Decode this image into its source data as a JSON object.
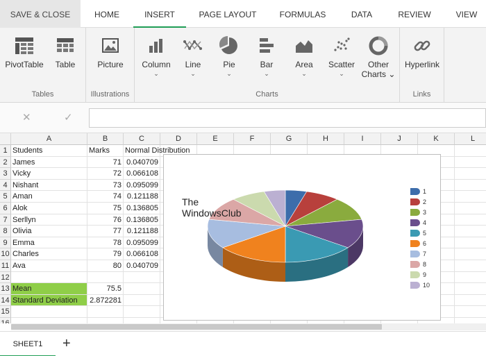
{
  "tabs": {
    "save": "SAVE & CLOSE",
    "home": "HOME",
    "insert": "INSERT",
    "page_layout": "PAGE LAYOUT",
    "formulas": "FORMULAS",
    "data": "DATA",
    "review": "REVIEW",
    "view": "VIEW"
  },
  "ribbon": {
    "pivottable": "PivotTable",
    "table": "Table",
    "picture": "Picture",
    "column": "Column",
    "line": "Line",
    "pie": "Pie",
    "bar": "Bar",
    "area": "Area",
    "scatter": "Scatter",
    "other_charts_1": "Other",
    "other_charts_2": "Charts",
    "hyperlink": "Hyperlink",
    "group_tables": "Tables",
    "group_illustrations": "Illustrations",
    "group_charts": "Charts",
    "group_links": "Links",
    "chevron": "⌄"
  },
  "formula_bar": {
    "cancel": "✕",
    "confirm": "✓",
    "value": ""
  },
  "columns": [
    "A",
    "B",
    "C",
    "D",
    "E",
    "F",
    "G",
    "H",
    "I",
    "J",
    "K",
    "L"
  ],
  "rows": [
    "1",
    "2",
    "3",
    "4",
    "5",
    "6",
    "7",
    "8",
    "9",
    "10",
    "11",
    "12",
    "13",
    "14",
    "15",
    "16"
  ],
  "sheet": {
    "header": {
      "students": "Students",
      "marks": "Marks",
      "normal": "Normal Distribution"
    },
    "records": [
      {
        "name": "James",
        "marks": "71",
        "nd": "0.040709"
      },
      {
        "name": "Vicky",
        "marks": "72",
        "nd": "0.066108"
      },
      {
        "name": "Nishant",
        "marks": "73",
        "nd": "0.095099"
      },
      {
        "name": "Aman",
        "marks": "74",
        "nd": "0.121188"
      },
      {
        "name": "Alok",
        "marks": "75",
        "nd": "0.136805"
      },
      {
        "name": "Serllyn",
        "marks": "76",
        "nd": "0.136805"
      },
      {
        "name": "Olivia",
        "marks": "77",
        "nd": "0.121188"
      },
      {
        "name": "Emma",
        "marks": "78",
        "nd": "0.095099"
      },
      {
        "name": "Charles",
        "marks": "79",
        "nd": "0.066108"
      },
      {
        "name": "Ava",
        "marks": "80",
        "nd": "0.040709"
      }
    ],
    "mean_label": "Mean",
    "mean_value": "75.5",
    "sd_label": "Standard Deviation",
    "sd_value": "2.872281"
  },
  "watermark": {
    "line1": "The",
    "line2": "WindowsClub"
  },
  "chart_data": {
    "type": "pie",
    "categories": [
      "1",
      "2",
      "3",
      "4",
      "5",
      "6",
      "7",
      "8",
      "9",
      "10"
    ],
    "values": [
      0.040709,
      0.066108,
      0.095099,
      0.121188,
      0.136805,
      0.136805,
      0.121188,
      0.095099,
      0.066108,
      0.040709
    ],
    "colors": [
      "#3d6dab",
      "#b8403c",
      "#8aab3e",
      "#6a4e8c",
      "#3a9ab3",
      "#f0821e",
      "#a7bde0",
      "#dba7a6",
      "#cbdaae",
      "#bbb0d2"
    ],
    "legend_position": "right",
    "style": "3d"
  },
  "sheet_tabs": {
    "sheet1": "SHEET1",
    "add": "+"
  }
}
